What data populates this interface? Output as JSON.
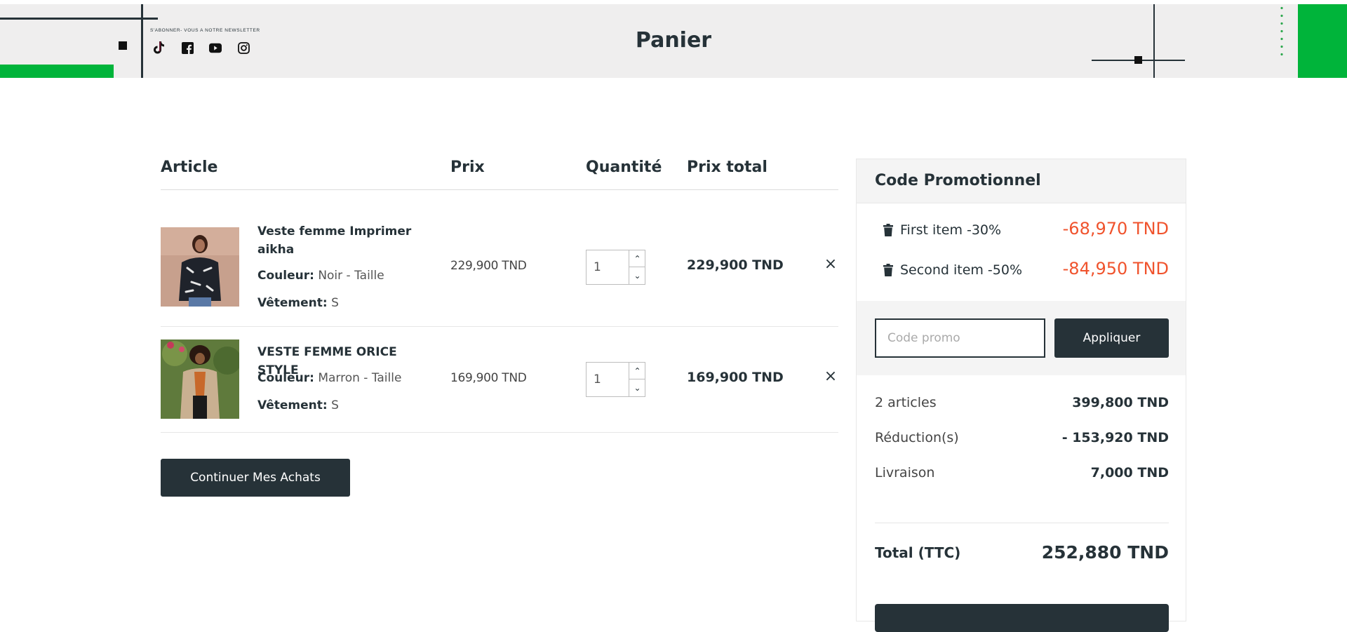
{
  "header": {
    "title": "Panier",
    "newsletter": "S'ABONNER- VOUS A NOTRE NEWSLETTER",
    "socials": [
      "tiktok-icon",
      "facebook-icon",
      "youtube-icon",
      "instagram-icon"
    ],
    "accent_color": "#00b43a"
  },
  "cart": {
    "columns": [
      "Article",
      "Prix",
      "Quantité",
      "Prix total"
    ],
    "items": [
      {
        "name": "Veste femme Imprimer aikha",
        "color_label": "Couleur:",
        "color_value": "Noir - Taille",
        "size_label": "Vêtement:",
        "size_value": "S",
        "price": "229,900 TND",
        "quantity": "1",
        "total": "229,900 TND"
      },
      {
        "name": "VESTE FEMME ORICE STYLE",
        "color_label": "Couleur:",
        "color_value": "Marron - Taille",
        "size_label": "Vêtement:",
        "size_value": "S",
        "price": "169,900 TND",
        "quantity": "1",
        "total": "169,900 TND"
      }
    ],
    "continue_label": "Continuer Mes Achats"
  },
  "summary": {
    "title": "Code Promotionnel",
    "promotions": [
      {
        "label": "First item -30%",
        "value": "-68,970 TND"
      },
      {
        "label": "Second item -50%",
        "value": "-84,950 TND"
      }
    ],
    "promo_placeholder": "Code promo",
    "apply_label": "Appliquer",
    "lines": [
      {
        "label": "2 articles",
        "value": "399,800 TND"
      },
      {
        "label": "Réduction(s)",
        "value": "- 153,920 TND"
      },
      {
        "label": "Livraison",
        "value": "7,000 TND"
      }
    ],
    "total_label": "Total (TTC)",
    "total_value": "252,880 TND",
    "discount_color": "#f0532d",
    "primary_color": "#263238"
  }
}
